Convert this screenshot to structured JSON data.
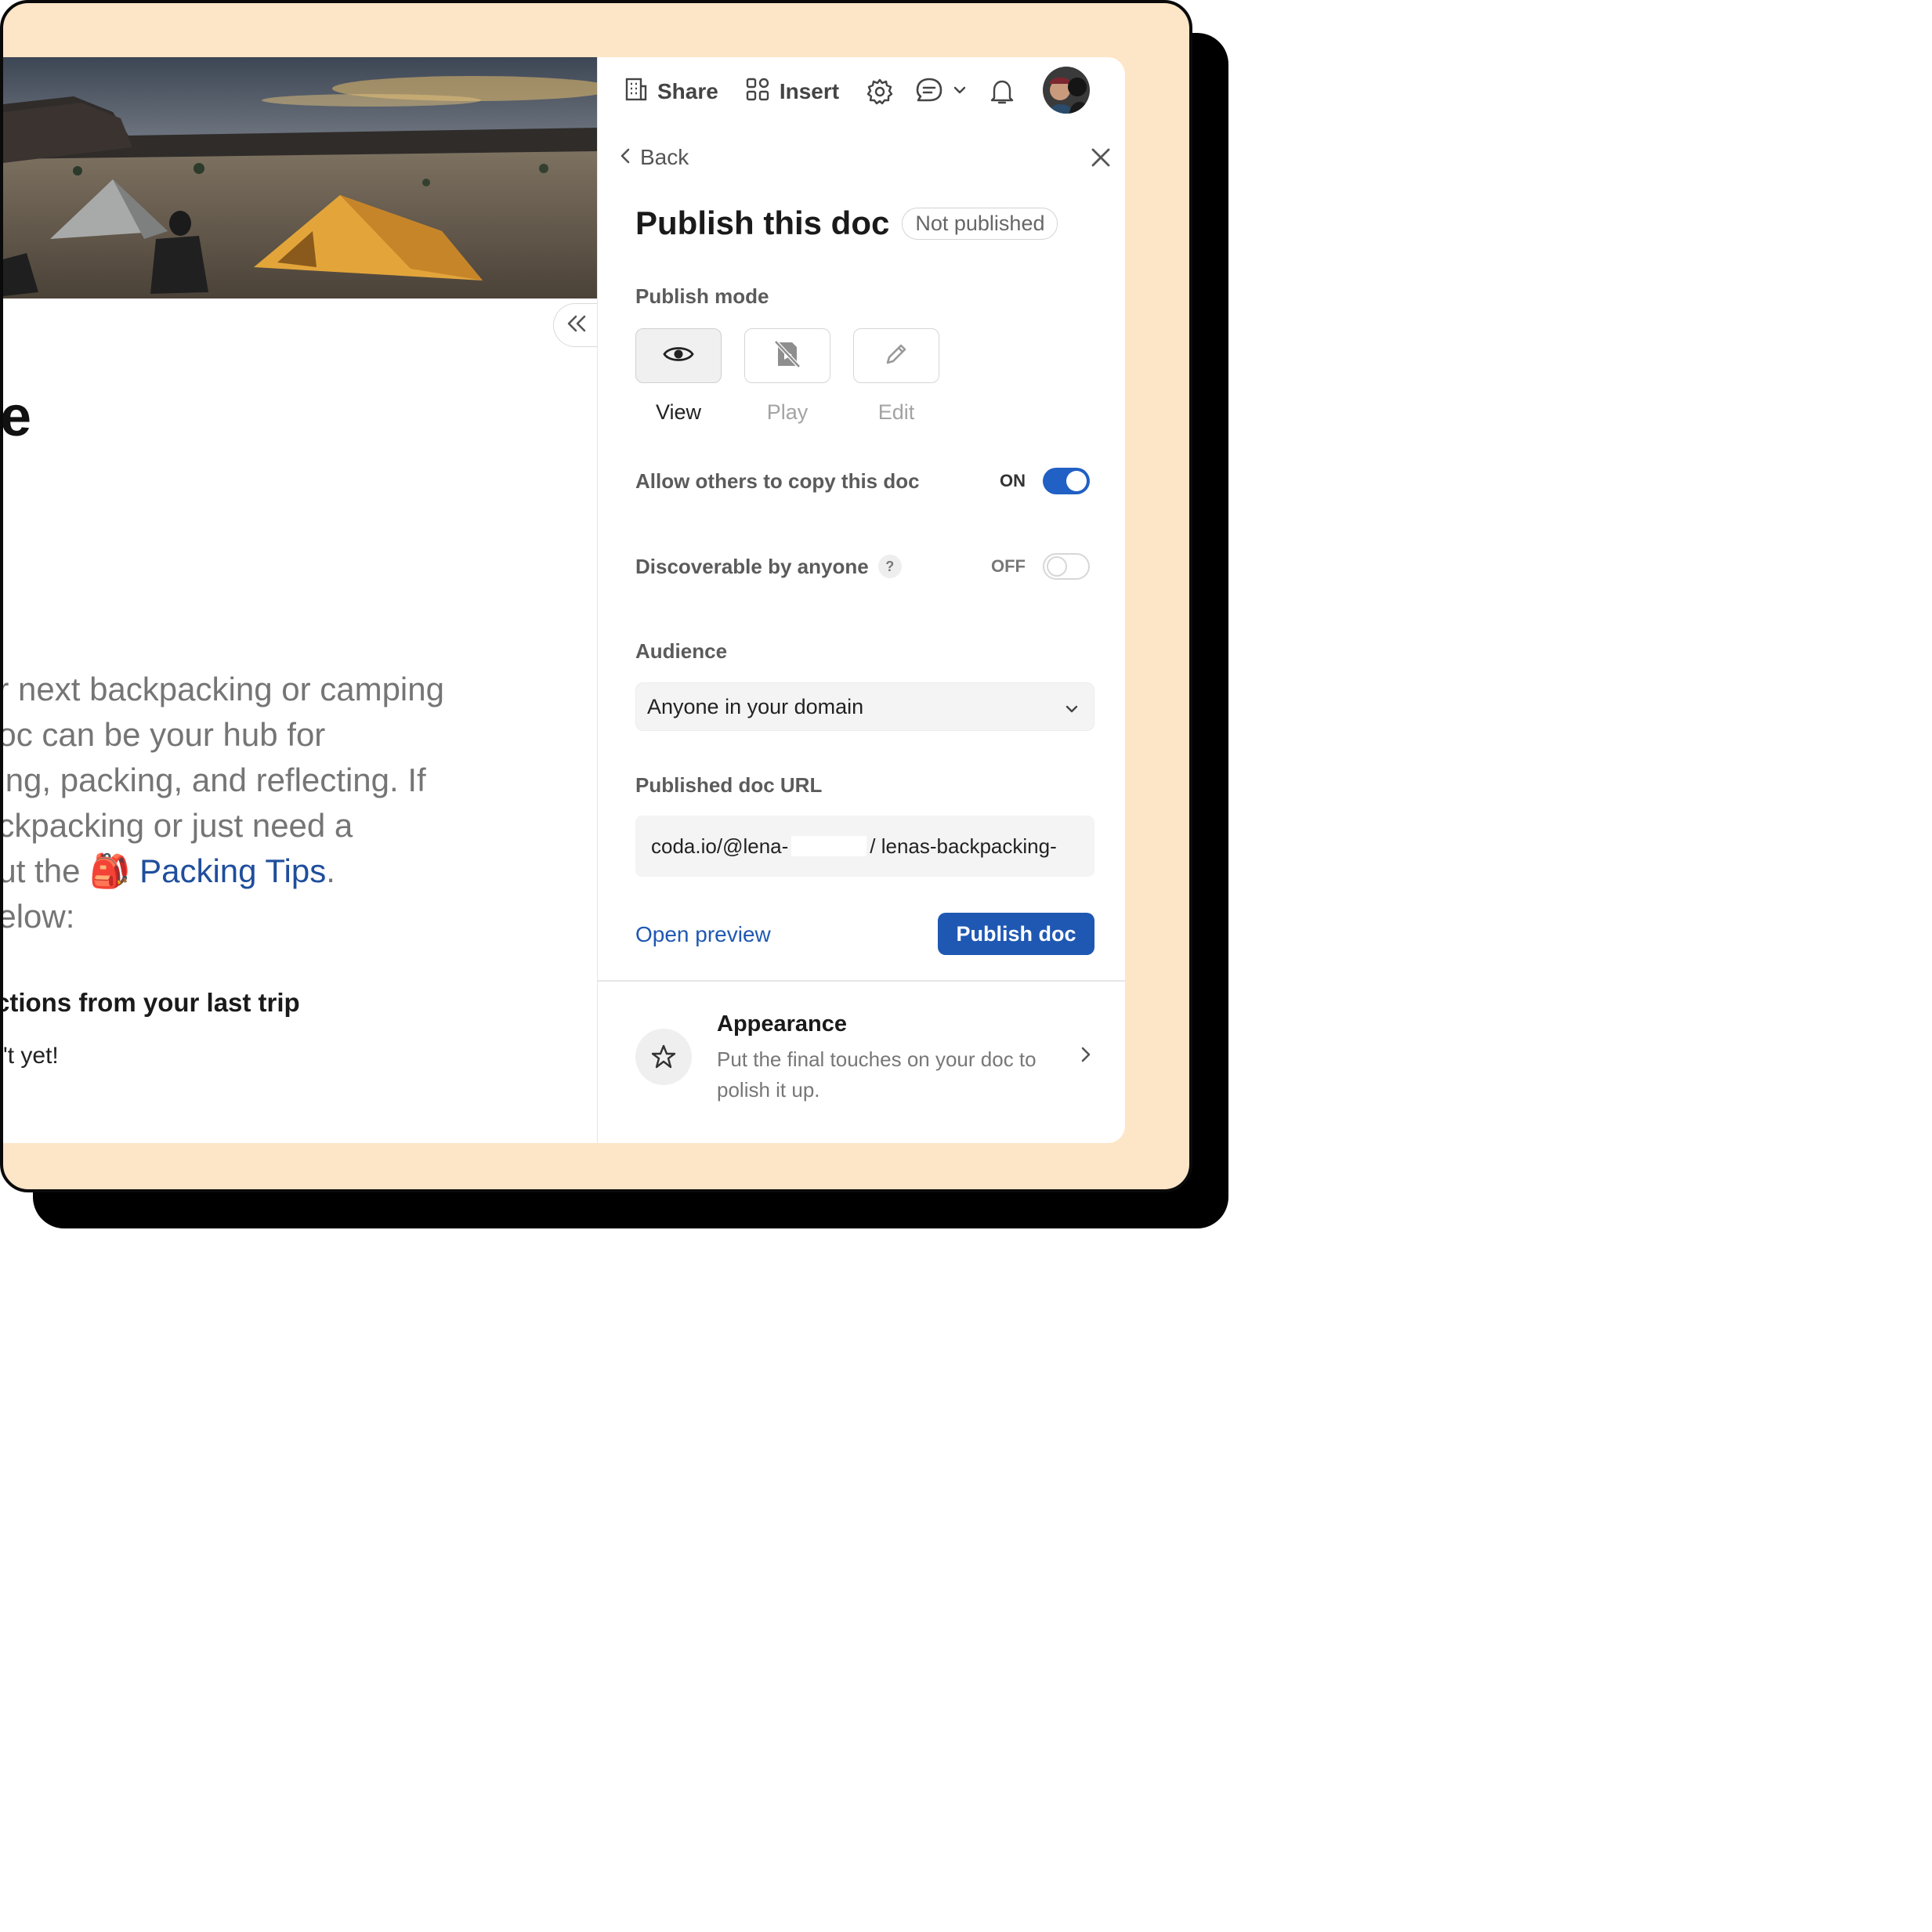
{
  "doc": {
    "title_fragment": "re",
    "paragraph_lines": [
      "ur next backpacking or camping",
      " doc can be your hub for",
      "ning, packing, and reflecting. If",
      "ackpacking or just need a",
      " out the ",
      " below:"
    ],
    "packing_tips_link": "Packing Tips",
    "link_suffix": ".",
    "subheading": "ctions from your last trip",
    "small_text": "'t yet!"
  },
  "topbar": {
    "share_label": "Share",
    "insert_label": "Insert"
  },
  "panel": {
    "back_label": "Back",
    "title": "Publish this doc",
    "status_badge": "Not published",
    "publish_mode_label": "Publish mode",
    "modes": [
      {
        "label": "View",
        "active": true
      },
      {
        "label": "Play",
        "active": false
      },
      {
        "label": "Edit",
        "active": false
      }
    ],
    "allow_copy": {
      "label": "Allow others to copy this doc",
      "state": "ON"
    },
    "discoverable": {
      "label": "Discoverable by anyone",
      "help": "?",
      "state": "OFF"
    },
    "audience_label": "Audience",
    "audience_value": "Anyone in your domain",
    "url_label": "Published doc URL",
    "url_prefix": "coda.io/@lena-",
    "url_suffix": "/ lenas-backpacking-",
    "open_preview": "Open preview",
    "publish_button": "Publish doc",
    "appearance": {
      "title": "Appearance",
      "description": "Put the final touches on your doc to polish it up."
    }
  },
  "colors": {
    "frame_bg": "#fde5c7",
    "accent": "#1f58b3",
    "link": "#1f4e9c"
  }
}
